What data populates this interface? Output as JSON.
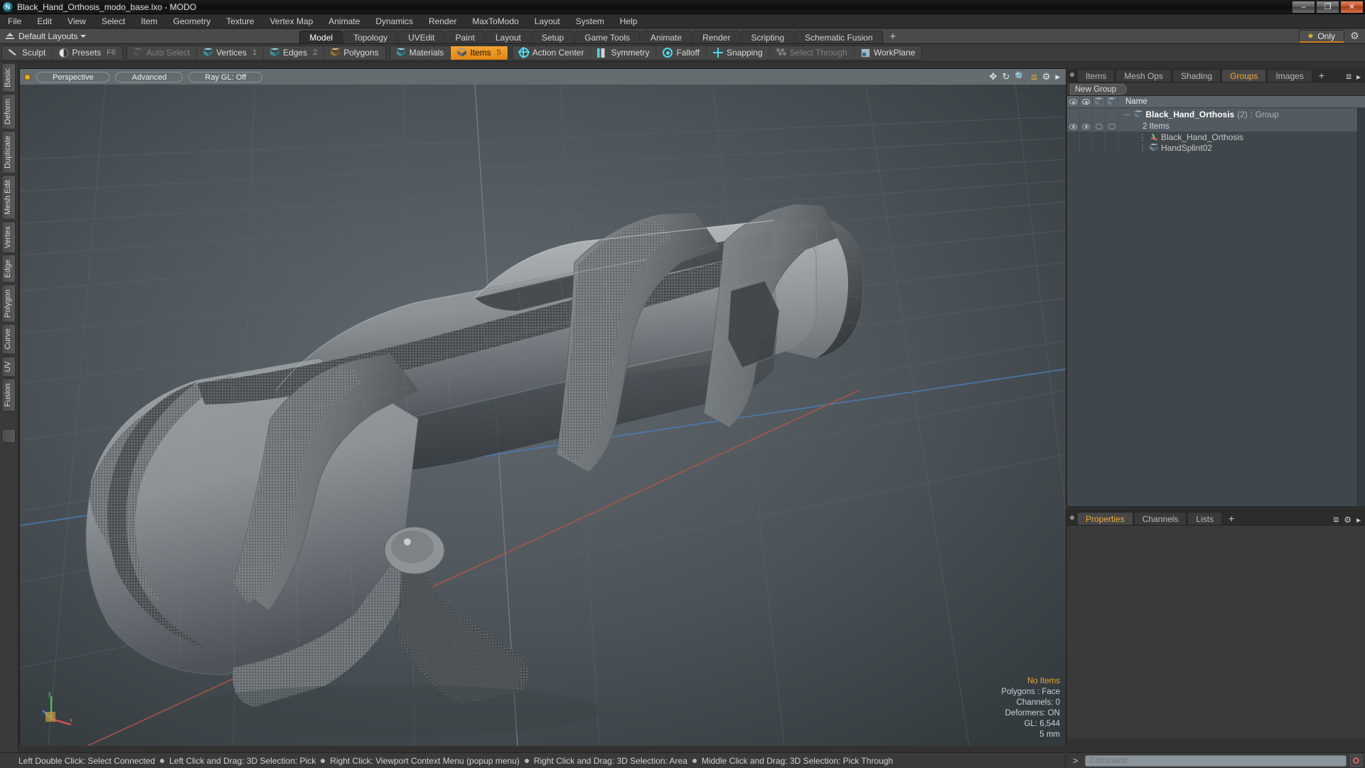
{
  "window": {
    "title": "Black_Hand_Orthosis_modo_base.lxo - MODO",
    "app_icon": "modo-app-icon",
    "controls": {
      "minimize": "–",
      "maximize": "❐",
      "close": "✕"
    }
  },
  "menubar": {
    "items": [
      "File",
      "Edit",
      "View",
      "Select",
      "Item",
      "Geometry",
      "Texture",
      "Vertex Map",
      "Animate",
      "Dynamics",
      "Render",
      "MaxToModo",
      "Layout",
      "System",
      "Help"
    ]
  },
  "layoutbar": {
    "layouts_label": "Default Layouts",
    "tabs": [
      {
        "label": "Model",
        "active": true
      },
      {
        "label": "Topology",
        "active": false
      },
      {
        "label": "UVEdit",
        "active": false
      },
      {
        "label": "Paint",
        "active": false
      },
      {
        "label": "Layout",
        "active": false
      },
      {
        "label": "Setup",
        "active": false
      },
      {
        "label": "Game Tools",
        "active": false
      },
      {
        "label": "Animate",
        "active": false
      },
      {
        "label": "Render",
        "active": false
      },
      {
        "label": "Scripting",
        "active": false
      },
      {
        "label": "Schematic Fusion",
        "active": false
      }
    ],
    "add_tab": "+",
    "only_button": "Only",
    "gear": "gear-icon"
  },
  "modebar": {
    "group1": [
      {
        "label": "Sculpt",
        "icon": "sculpt-icon",
        "state": "normal",
        "shortcut": ""
      },
      {
        "label": "Presets",
        "icon": "presets-icon",
        "state": "normal",
        "shortcut": "F6"
      }
    ],
    "group2": [
      {
        "label": "Auto Select",
        "icon": "cube-icon",
        "state": "disabled",
        "shortcut": ""
      },
      {
        "label": "Vertices",
        "icon": "cube-icon",
        "state": "normal",
        "shortcut": "1"
      },
      {
        "label": "Edges",
        "icon": "cube-icon",
        "state": "normal",
        "shortcut": "2"
      },
      {
        "label": "Polygons",
        "icon": "cube-icon",
        "state": "normal",
        "shortcut": ""
      }
    ],
    "group3": [
      {
        "label": "Materials",
        "icon": "cube-icon",
        "state": "normal",
        "shortcut": ""
      },
      {
        "label": "Items",
        "icon": "cube-icon",
        "state": "active",
        "shortcut": "5"
      }
    ],
    "group4": [
      {
        "label": "Action Center",
        "icon": "action-center-icon",
        "state": "normal",
        "shortcut": ""
      },
      {
        "label": "Symmetry",
        "icon": "symmetry-icon",
        "state": "normal",
        "shortcut": ""
      },
      {
        "label": "Falloff",
        "icon": "falloff-icon",
        "state": "normal",
        "shortcut": ""
      },
      {
        "label": "Snapping",
        "icon": "snapping-icon",
        "state": "normal",
        "shortcut": ""
      },
      {
        "label": "Select Through",
        "icon": "select-through-icon",
        "state": "disabled",
        "shortcut": ""
      },
      {
        "label": "WorkPlane",
        "icon": "workplane-icon",
        "state": "normal",
        "shortcut": ""
      }
    ]
  },
  "left_toolbar": {
    "tabs": [
      "Basic",
      "Deform",
      "Duplicate",
      "Mesh Edit",
      "Vertex",
      "Edge",
      "Polygon",
      "Curve",
      "UV",
      "Fusion"
    ]
  },
  "viewport": {
    "header_buttons": [
      "Perspective",
      "Advanced",
      "Ray GL: Off"
    ],
    "tool_icons": [
      "move-icon",
      "rotate-icon",
      "zoom-icon",
      "fit-icon",
      "gear-icon",
      "chevron-right-icon"
    ],
    "stats": {
      "selection": "No Items",
      "polygons": "Polygons : Face",
      "channels": "Channels: 0",
      "deformers": "Deformers: ON",
      "gl": "GL: 6,544",
      "grid": "5 mm"
    },
    "axis_labels": [
      "y",
      "x",
      "z"
    ]
  },
  "right_panel": {
    "tabs": [
      {
        "label": "Items",
        "active": false
      },
      {
        "label": "Mesh Ops",
        "active": false
      },
      {
        "label": "Shading",
        "active": false
      },
      {
        "label": "Groups",
        "active": true
      },
      {
        "label": "Images",
        "active": false
      }
    ],
    "add_tab": "+",
    "new_group_button": "New Group",
    "tree_columns": [
      "visible-eye-icon",
      "render-icon",
      "lock-icon",
      "select-icon",
      "Name"
    ],
    "tree_name_header": "Name",
    "tree": [
      {
        "name": "Black_Hand_Orthosis",
        "count": "(2)",
        "type": ": Group",
        "subtitle": "2 Items",
        "icon": "group-cube-icon",
        "selected": true
      },
      {
        "name": "Black_Hand_Orthosis",
        "icon": "locator-icon",
        "selected": false
      },
      {
        "name": "HandSplint02",
        "icon": "mesh-cube-icon",
        "selected": false
      }
    ],
    "bottom_tabs": [
      {
        "label": "Properties",
        "active": true
      },
      {
        "label": "Channels",
        "active": false
      },
      {
        "label": "Lists",
        "active": false
      }
    ],
    "bottom_add_tab": "+"
  },
  "statusbar": {
    "hints": [
      "Left Double Click: Select Connected",
      "Left Click and Drag: 3D Selection: Pick",
      "Right Click: Viewport Context Menu (popup menu)",
      "Right Click and Drag: 3D Selection: Area",
      "Middle Click and Drag: 3D Selection: Pick Through"
    ]
  },
  "command_bar": {
    "prompt": ">",
    "placeholder": "Command",
    "value": "",
    "record_button": "record-icon"
  },
  "colors": {
    "accent_orange": "#f0a93a",
    "active_tab_orange": "#e08713",
    "panel_bg": "#323232",
    "viewport_bg": "#4d5459",
    "tree_bg": "#3f474c"
  }
}
